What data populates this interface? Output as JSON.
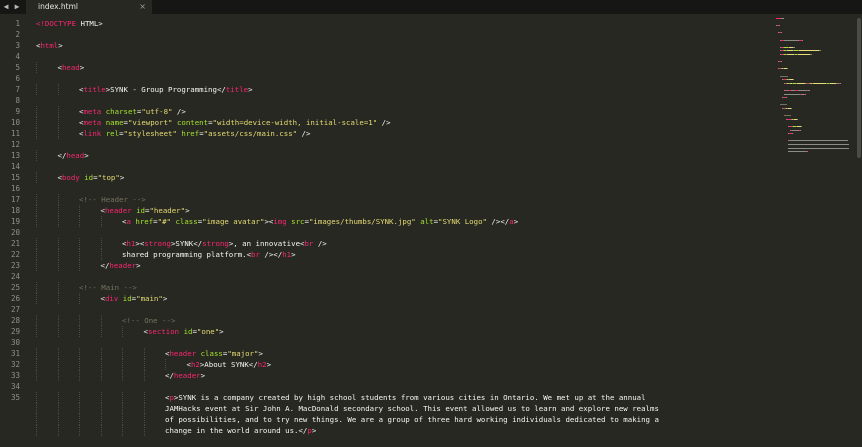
{
  "window": {
    "nav_back_icon": "◀",
    "nav_forward_icon": "▶",
    "tab": {
      "label": "index.html",
      "close_icon": "×"
    }
  },
  "colors": {
    "background": "#272822",
    "tag": "#f92672",
    "attribute": "#a6e22e",
    "string": "#e6db74",
    "text": "#f8f8f2",
    "comment": "#75715e",
    "line_number": "#90908a"
  },
  "editor": {
    "lines": [
      {
        "n": "1",
        "indent": 0,
        "tokens": [
          [
            "tag",
            "<"
          ],
          [
            "tag",
            "!DOCTYPE"
          ],
          [
            "txt",
            " HTML>"
          ]
        ]
      },
      {
        "n": "2",
        "indent": 0,
        "tokens": []
      },
      {
        "n": "3",
        "indent": 0,
        "tokens": [
          [
            "txt",
            "<"
          ],
          [
            "tag",
            "html"
          ],
          [
            "txt",
            ">"
          ]
        ]
      },
      {
        "n": "4",
        "indent": 0,
        "tokens": []
      },
      {
        "n": "5",
        "indent": 1,
        "tokens": [
          [
            "txt",
            "<"
          ],
          [
            "tag",
            "head"
          ],
          [
            "txt",
            ">"
          ]
        ]
      },
      {
        "n": "6",
        "indent": 0,
        "tokens": []
      },
      {
        "n": "7",
        "indent": 2,
        "tokens": [
          [
            "txt",
            "<"
          ],
          [
            "tag",
            "title"
          ],
          [
            "txt",
            ">SYNK - Group Programming</"
          ],
          [
            "tag",
            "title"
          ],
          [
            "txt",
            ">"
          ]
        ]
      },
      {
        "n": "8",
        "indent": 0,
        "tokens": []
      },
      {
        "n": "9",
        "indent": 2,
        "tokens": [
          [
            "txt",
            "<"
          ],
          [
            "tag",
            "meta"
          ],
          [
            "txt",
            " "
          ],
          [
            "attr",
            "charset"
          ],
          [
            "txt",
            "="
          ],
          [
            "str",
            "\"utf-8\""
          ],
          [
            "txt",
            " />"
          ]
        ]
      },
      {
        "n": "10",
        "indent": 2,
        "tokens": [
          [
            "txt",
            "<"
          ],
          [
            "tag",
            "meta"
          ],
          [
            "txt",
            " "
          ],
          [
            "attr",
            "name"
          ],
          [
            "txt",
            "="
          ],
          [
            "str",
            "\"viewport\""
          ],
          [
            "txt",
            " "
          ],
          [
            "attr",
            "content"
          ],
          [
            "txt",
            "="
          ],
          [
            "str",
            "\"width=device-width, initial-scale=1\""
          ],
          [
            "txt",
            " />"
          ]
        ]
      },
      {
        "n": "11",
        "indent": 2,
        "tokens": [
          [
            "txt",
            "<"
          ],
          [
            "tag",
            "link"
          ],
          [
            "txt",
            " "
          ],
          [
            "attr",
            "rel"
          ],
          [
            "txt",
            "="
          ],
          [
            "str",
            "\"stylesheet\""
          ],
          [
            "txt",
            " "
          ],
          [
            "attr",
            "href"
          ],
          [
            "txt",
            "="
          ],
          [
            "str",
            "\"assets/css/main.css\""
          ],
          [
            "txt",
            " />"
          ]
        ]
      },
      {
        "n": "12",
        "indent": 0,
        "tokens": []
      },
      {
        "n": "13",
        "indent": 1,
        "tokens": [
          [
            "txt",
            "</"
          ],
          [
            "tag",
            "head"
          ],
          [
            "txt",
            ">"
          ]
        ]
      },
      {
        "n": "14",
        "indent": 0,
        "tokens": []
      },
      {
        "n": "15",
        "indent": 1,
        "tokens": [
          [
            "txt",
            "<"
          ],
          [
            "tag",
            "body"
          ],
          [
            "txt",
            " "
          ],
          [
            "attr",
            "id"
          ],
          [
            "txt",
            "="
          ],
          [
            "str",
            "\"top\""
          ],
          [
            "txt",
            ">"
          ]
        ]
      },
      {
        "n": "16",
        "indent": 0,
        "tokens": []
      },
      {
        "n": "17",
        "indent": 2,
        "tokens": [
          [
            "cmt",
            "<!-- Header -->"
          ]
        ]
      },
      {
        "n": "18",
        "indent": 3,
        "tokens": [
          [
            "txt",
            "<"
          ],
          [
            "tag",
            "header"
          ],
          [
            "txt",
            " "
          ],
          [
            "attr",
            "id"
          ],
          [
            "txt",
            "="
          ],
          [
            "str",
            "\"header\""
          ],
          [
            "txt",
            ">"
          ]
        ]
      },
      {
        "n": "19",
        "indent": 4,
        "tokens": [
          [
            "txt",
            "<"
          ],
          [
            "tag",
            "a"
          ],
          [
            "txt",
            " "
          ],
          [
            "attr",
            "href"
          ],
          [
            "txt",
            "="
          ],
          [
            "str",
            "\"#\""
          ],
          [
            "txt",
            " "
          ],
          [
            "attr",
            "class"
          ],
          [
            "txt",
            "="
          ],
          [
            "str",
            "\"image avatar\""
          ],
          [
            "txt",
            ">"
          ],
          [
            "txt",
            "<"
          ],
          [
            "tag",
            "img"
          ],
          [
            "txt",
            " "
          ],
          [
            "attr",
            "src"
          ],
          [
            "txt",
            "="
          ],
          [
            "str",
            "\"images/thumbs/SYNK.jpg\""
          ],
          [
            "txt",
            " "
          ],
          [
            "attr",
            "alt"
          ],
          [
            "txt",
            "="
          ],
          [
            "str",
            "\"SYNK Logo\""
          ],
          [
            "txt",
            " /></"
          ],
          [
            "tag",
            "a"
          ],
          [
            "txt",
            ">"
          ]
        ]
      },
      {
        "n": "20",
        "indent": 0,
        "tokens": []
      },
      {
        "n": "21",
        "indent": 4,
        "tokens": [
          [
            "txt",
            "<"
          ],
          [
            "tag",
            "h1"
          ],
          [
            "txt",
            ">"
          ],
          [
            "txt",
            "<"
          ],
          [
            "tag",
            "strong"
          ],
          [
            "txt",
            ">SYNK</"
          ],
          [
            "tag",
            "strong"
          ],
          [
            "txt",
            ">, an innovative<"
          ],
          [
            "tag",
            "br"
          ],
          [
            "txt",
            " />"
          ]
        ]
      },
      {
        "n": "22",
        "indent": 4,
        "tokens": [
          [
            "txt",
            "shared programming platform.<"
          ],
          [
            "tag",
            "br"
          ],
          [
            "txt",
            " /></"
          ],
          [
            "tag",
            "h1"
          ],
          [
            "txt",
            ">"
          ]
        ]
      },
      {
        "n": "23",
        "indent": 3,
        "tokens": [
          [
            "txt",
            "</"
          ],
          [
            "tag",
            "header"
          ],
          [
            "txt",
            ">"
          ]
        ]
      },
      {
        "n": "24",
        "indent": 0,
        "tokens": []
      },
      {
        "n": "25",
        "indent": 2,
        "tokens": [
          [
            "cmt",
            "<!-- Main -->"
          ]
        ]
      },
      {
        "n": "26",
        "indent": 3,
        "tokens": [
          [
            "txt",
            "<"
          ],
          [
            "tag",
            "div"
          ],
          [
            "txt",
            " "
          ],
          [
            "attr",
            "id"
          ],
          [
            "txt",
            "="
          ],
          [
            "str",
            "\"main\""
          ],
          [
            "txt",
            ">"
          ]
        ]
      },
      {
        "n": "27",
        "indent": 0,
        "tokens": []
      },
      {
        "n": "28",
        "indent": 4,
        "tokens": [
          [
            "cmt",
            "<!-- One -->"
          ]
        ]
      },
      {
        "n": "29",
        "indent": 5,
        "tokens": [
          [
            "txt",
            "<"
          ],
          [
            "tag",
            "section"
          ],
          [
            "txt",
            " "
          ],
          [
            "attr",
            "id"
          ],
          [
            "txt",
            "="
          ],
          [
            "str",
            "\"one\""
          ],
          [
            "txt",
            ">"
          ]
        ]
      },
      {
        "n": "30",
        "indent": 0,
        "tokens": []
      },
      {
        "n": "31",
        "indent": 6,
        "tokens": [
          [
            "txt",
            "<"
          ],
          [
            "tag",
            "header"
          ],
          [
            "txt",
            " "
          ],
          [
            "attr",
            "class"
          ],
          [
            "txt",
            "="
          ],
          [
            "str",
            "\"major\""
          ],
          [
            "txt",
            ">"
          ]
        ]
      },
      {
        "n": "32",
        "indent": 7,
        "tokens": [
          [
            "txt",
            "<"
          ],
          [
            "tag",
            "h2"
          ],
          [
            "txt",
            ">About SYNK</"
          ],
          [
            "tag",
            "h2"
          ],
          [
            "txt",
            ">"
          ]
        ]
      },
      {
        "n": "33",
        "indent": 6,
        "tokens": [
          [
            "txt",
            "</"
          ],
          [
            "tag",
            "header"
          ],
          [
            "txt",
            ">"
          ]
        ]
      },
      {
        "n": "34",
        "indent": 0,
        "tokens": []
      },
      {
        "n": "35",
        "indent": 6,
        "tokens": [
          [
            "txt",
            "<"
          ],
          [
            "tag",
            "p"
          ],
          [
            "txt",
            ">SYNK is a company created by high school students from various cities in Ontario. We met up at the annual"
          ]
        ]
      },
      {
        "n": "",
        "indent": 6,
        "tokens": [
          [
            "txt",
            "JAMHacks event at Sir John A. MacDonald secondary school. This event allowed us to learn and explore new realms"
          ]
        ]
      },
      {
        "n": "",
        "indent": 6,
        "tokens": [
          [
            "txt",
            "of possibilities, and to try new things. We are a group of three hard working individuals dedicated to making a"
          ]
        ]
      },
      {
        "n": "",
        "indent": 6,
        "tokens": [
          [
            "txt",
            "change in the world around us.</"
          ],
          [
            "tag",
            "p"
          ],
          [
            "txt",
            ">"
          ]
        ]
      },
      {
        "n": "",
        "indent": 0,
        "tokens": []
      },
      {
        "n": "36",
        "indent": 0,
        "tokens": []
      }
    ]
  }
}
